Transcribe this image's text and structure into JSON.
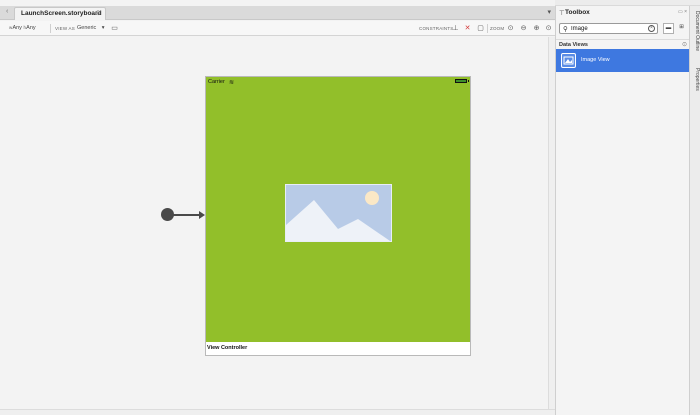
{
  "editor": {
    "tab_nav": "‹",
    "tab_label": "LaunchScreen.storyboard",
    "tab_close": "⊗",
    "tabbar_menu": "▾"
  },
  "toolbar": {
    "w_prefix": "w",
    "w_value": "Any",
    "h_prefix": "h",
    "h_value": "Any",
    "view_as_label": "VIEW AS",
    "device_value": "Generic",
    "dropdown_arrow": "▾",
    "constraints_label": "CONSTRAINTS",
    "zoom_label": "ZOOM"
  },
  "canvas": {
    "status_carrier": "Carrier",
    "view_controller_label": "View Controller",
    "screen_color": "#92bf2a"
  },
  "toolbox": {
    "title": "Toolbox",
    "search_value": "Image",
    "section_label": "Data Views",
    "selected_item": "Image View",
    "accent_color": "#3e78e0"
  },
  "side_tabs": {
    "document_outline": "Document Outline",
    "properties": "Properties"
  }
}
